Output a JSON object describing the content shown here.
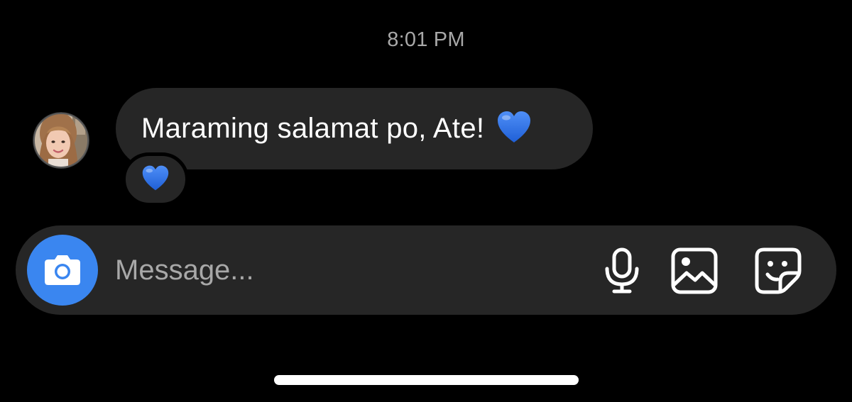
{
  "thread": {
    "timestamp": "8:01 PM",
    "message": {
      "text": "Maraming salamat po, Ate!",
      "emoji": "blue-heart",
      "reaction": "blue-heart"
    }
  },
  "composer": {
    "placeholder": "Message...",
    "value": "",
    "camera_icon": "camera-icon",
    "mic_icon": "microphone-icon",
    "gallery_icon": "gallery-icon",
    "sticker_icon": "sticker-icon"
  },
  "colors": {
    "background": "#000000",
    "bubble": "#262626",
    "accent": "#3a86f0",
    "heart": "#2f6fe6",
    "muted_text": "#a8a8a8"
  }
}
